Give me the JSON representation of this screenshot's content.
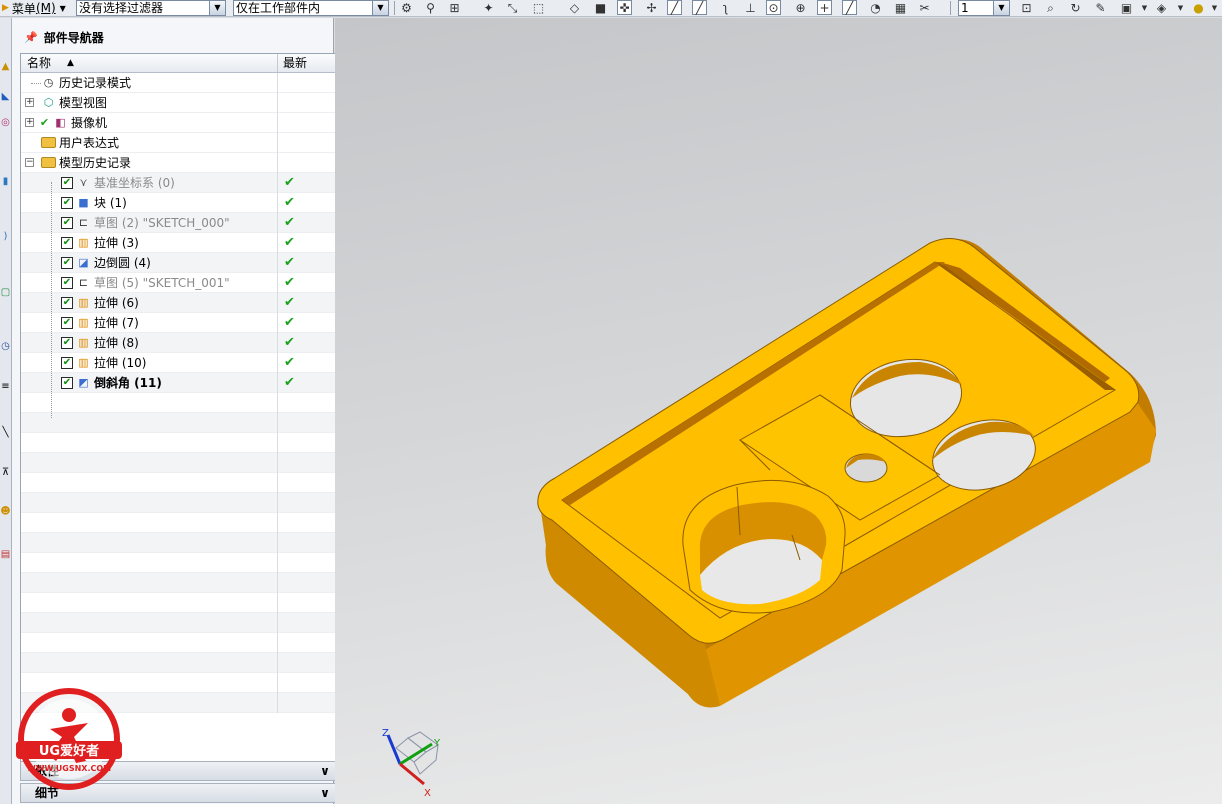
{
  "toolbar": {
    "menu_label": "菜单",
    "menu_key": "(M)",
    "filter_value": "没有选择过滤器",
    "scope_value": "仅在工作部件内",
    "layer_value": "1"
  },
  "navigator": {
    "title": "部件导航器",
    "col_name": "名称",
    "col_latest": "最新",
    "sort_glyph": "▲",
    "top_nodes": [
      {
        "label": "历史记录模式"
      },
      {
        "label": "模型视图"
      },
      {
        "label": "摄像机"
      },
      {
        "label": "用户表达式"
      },
      {
        "label": "模型历史记录"
      }
    ],
    "features": [
      {
        "label": "基准坐标系 (0)",
        "latest": "✔"
      },
      {
        "label": "块 (1)",
        "latest": "✔"
      },
      {
        "label": "草图 (2) \"SKETCH_000\"",
        "latest": "✔"
      },
      {
        "label": "拉伸 (3)",
        "latest": "✔"
      },
      {
        "label": "边倒圆 (4)",
        "latest": "✔"
      },
      {
        "label": "草图 (5) \"SKETCH_001\"",
        "latest": "✔"
      },
      {
        "label": "拉伸 (6)",
        "latest": "✔"
      },
      {
        "label": "拉伸 (7)",
        "latest": "✔"
      },
      {
        "label": "拉伸 (8)",
        "latest": "✔"
      },
      {
        "label": "拉伸 (10)",
        "latest": "✔"
      },
      {
        "label": "倒斜角 (11)",
        "latest": "✔"
      }
    ],
    "sections": [
      {
        "label": "依性"
      },
      {
        "label": "细节"
      }
    ]
  },
  "watermark": {
    "brand": "UG爱好者",
    "url": "WWW.UGSNX.COM"
  },
  "triad": {
    "x": "X",
    "y": "Y",
    "z": "Z"
  },
  "colors": {
    "part_top": "#ffc000",
    "part_side": "#d99000",
    "part_dark": "#b86f00",
    "check_green": "#1aa11a"
  }
}
